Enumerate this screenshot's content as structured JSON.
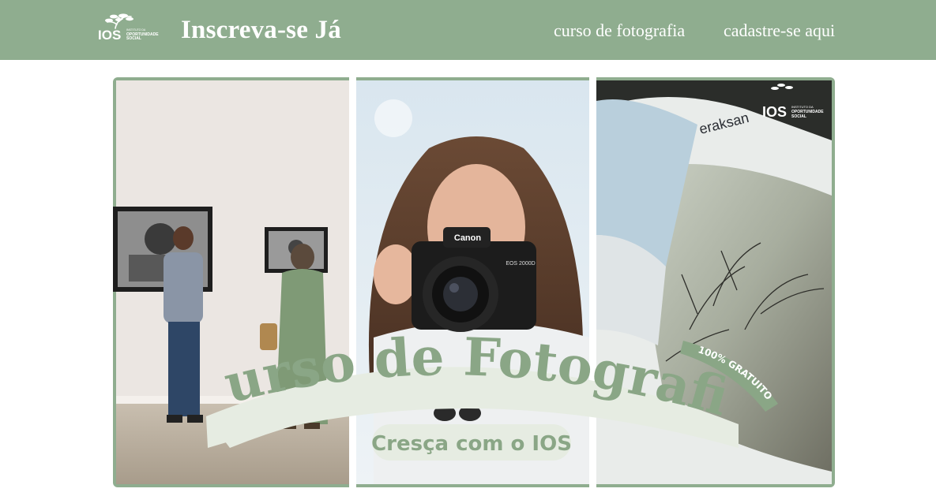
{
  "header": {
    "title": "Inscreva-se Já",
    "logo": {
      "letters": "IOS",
      "line1": "INSTITUTO DA",
      "line2": "OPORTUNIDADE",
      "line3": "SOCIAL",
      "icon": "tree-logo-icon"
    },
    "nav": [
      {
        "label": "curso de fotografia"
      },
      {
        "label": "cadastre-se aqui"
      }
    ]
  },
  "banner": {
    "headline": "Curso de Fotografia",
    "subtitle": "Cresça com o IOS",
    "badge": "100% GRATUITO",
    "camera_brand": "Canon",
    "camera_model": "EOS 2000D",
    "book_text": "eraksan",
    "watermark": {
      "letters": "IOS",
      "line1": "INSTITUTO DA",
      "line2": "OPORTUNIDADE",
      "line3": "SOCIAL"
    },
    "colors": {
      "frame": "#8fad8f",
      "headline": "#8aa686",
      "ribbon": "#e6ece2",
      "badge": "#8aa686"
    }
  }
}
